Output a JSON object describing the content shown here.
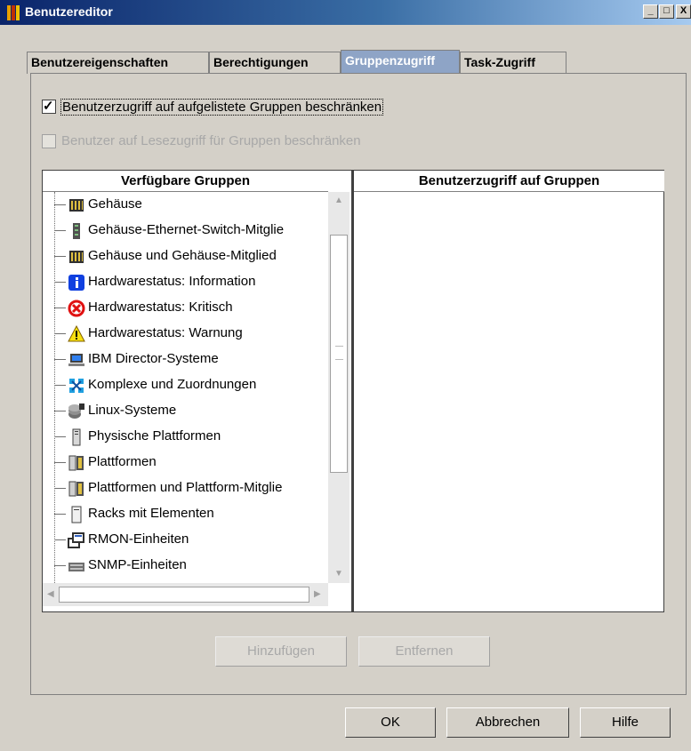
{
  "window": {
    "title": "Benutzereditor",
    "min_label": "_",
    "max_label": "□",
    "close_label": "X"
  },
  "tabs": [
    {
      "label": "Benutzereigenschaften"
    },
    {
      "label": "Berechtigungen"
    },
    {
      "label": "Gruppenzugriff"
    },
    {
      "label": "Task-Zugriff"
    }
  ],
  "active_tab": "Gruppenzugriff",
  "options": {
    "restrict_groups": {
      "label": "Benutzerzugriff auf aufgelistete Gruppen beschränken",
      "checked": true,
      "check_glyph": "✓"
    },
    "restrict_read": {
      "label": "Benutzer auf Lesezugriff für Gruppen beschränken",
      "checked": false,
      "enabled": false
    }
  },
  "available": {
    "header": "Verfügbare Gruppen",
    "items": [
      {
        "label": "Gehäuse",
        "icon": "chassis-icon"
      },
      {
        "label": "Gehäuse-Ethernet-Switch-Mitglie",
        "icon": "switch-icon"
      },
      {
        "label": "Gehäuse und Gehäuse-Mitglied",
        "icon": "chassis-icon"
      },
      {
        "label": "Hardwarestatus: Information",
        "icon": "info-icon"
      },
      {
        "label": "Hardwarestatus: Kritisch",
        "icon": "critical-icon"
      },
      {
        "label": "Hardwarestatus: Warnung",
        "icon": "warning-icon"
      },
      {
        "label": "IBM Director-Systeme",
        "icon": "computer-icon"
      },
      {
        "label": "Komplexe und Zuordnungen",
        "icon": "network-icon"
      },
      {
        "label": "Linux-Systeme",
        "icon": "linux-icon"
      },
      {
        "label": "Physische Plattformen",
        "icon": "server-icon"
      },
      {
        "label": "Plattformen",
        "icon": "platform-icon"
      },
      {
        "label": "Plattformen und Plattform-Mitglie",
        "icon": "platform-icon"
      },
      {
        "label": "Racks mit Elementen",
        "icon": "rack-icon"
      },
      {
        "label": "RMON-Einheiten",
        "icon": "rmon-icon"
      },
      {
        "label": "SNMP-Einheiten",
        "icon": "snmp-icon"
      }
    ]
  },
  "assigned": {
    "header": "Benutzerzugriff auf Gruppen",
    "items": []
  },
  "buttons": {
    "add": "Hinzufügen",
    "remove": "Entfernen",
    "ok": "OK",
    "cancel": "Abbrechen",
    "help": "Hilfe"
  },
  "colors": {
    "title_start": "#0a246a",
    "title_end": "#a6caf0",
    "active_tab": "#8ea4c6",
    "dialog_bg": "#d4d0c8"
  }
}
